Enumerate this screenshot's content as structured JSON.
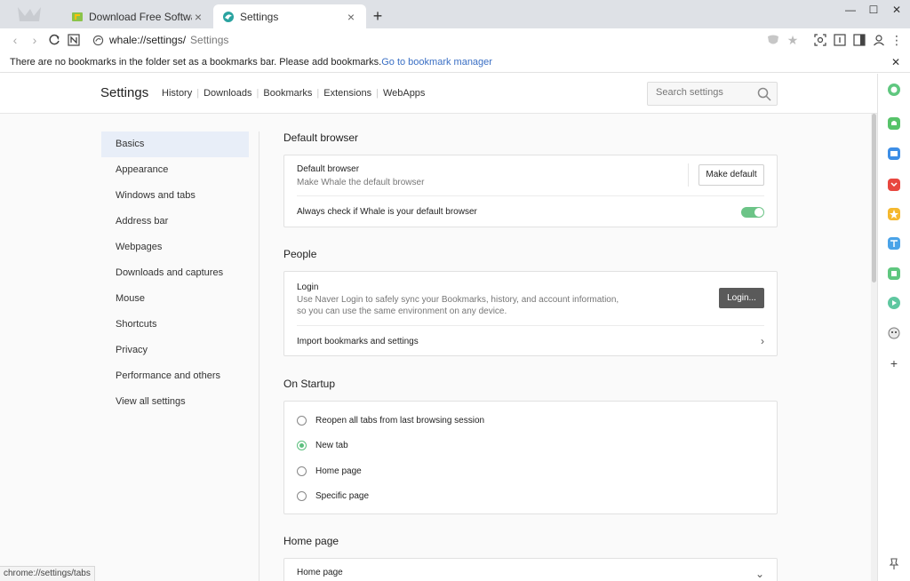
{
  "tabs": [
    {
      "title": "Download Free Software for Windows",
      "active": false
    },
    {
      "title": "Settings",
      "active": true
    }
  ],
  "toolbar": {
    "url": "whale://settings/",
    "page_label": "Settings"
  },
  "bookmarks_bar": {
    "message": "There are no bookmarks in the folder set as a bookmarks bar. Please add bookmarks.",
    "link": "Go to bookmark manager"
  },
  "header": {
    "title": "Settings",
    "links": [
      "History",
      "Downloads",
      "Bookmarks",
      "Extensions",
      "WebApps"
    ],
    "search_placeholder": "Search settings"
  },
  "nav": {
    "items": [
      "Basics",
      "Appearance",
      "Windows and tabs",
      "Address bar",
      "Webpages",
      "Downloads and captures",
      "Mouse",
      "Shortcuts",
      "Privacy",
      "Performance and others",
      "View all settings"
    ],
    "active": "Basics"
  },
  "sections": {
    "default_browser": {
      "title": "Default browser",
      "label": "Default browser",
      "sub": "Make Whale the default browser",
      "button": "Make default",
      "always_check": "Always check if Whale is your default browser",
      "always_check_on": true
    },
    "people": {
      "title": "People",
      "login_label": "Login",
      "login_sub_1": "Use Naver Login to safely sync your Bookmarks, history, and account information,",
      "login_sub_2": "so you can use the same environment on any device.",
      "login_button": "Login...",
      "import": "Import bookmarks and settings"
    },
    "startup": {
      "title": "On Startup",
      "options": [
        "Reopen all tabs from last browsing session",
        "New tab",
        "Home page",
        "Specific page"
      ],
      "selected": "New tab"
    },
    "home_page": {
      "title": "Home page",
      "label": "Home page"
    }
  },
  "status_url": "chrome://settings/tabs",
  "colors": {
    "accent_green": "#5cc07e",
    "link_blue": "#3a6fc4",
    "nav_active_bg": "#e8eef8"
  }
}
